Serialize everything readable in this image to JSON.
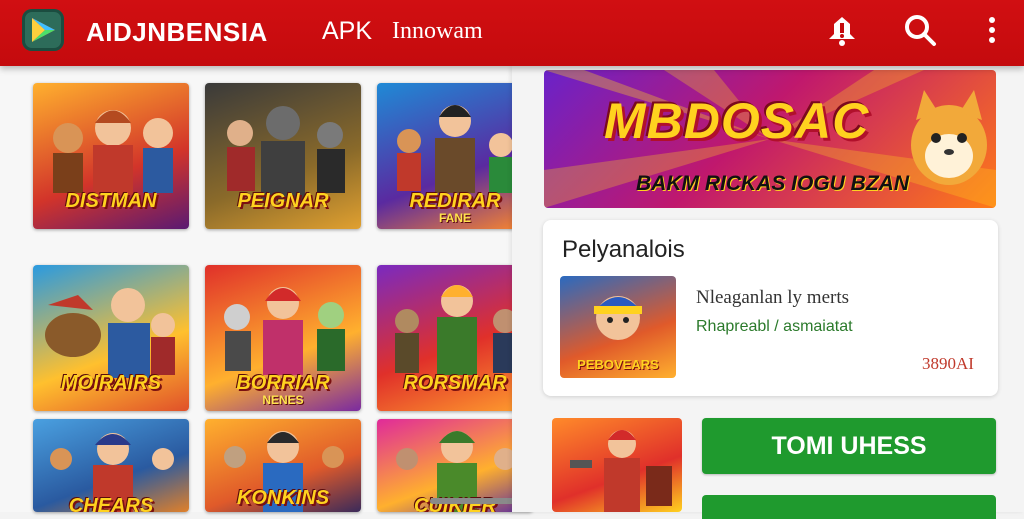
{
  "header": {
    "brand": "AIDJNBENSIA",
    "apk": "APK",
    "tagline": "Innowam",
    "icons": [
      "app-logo-icon",
      "notification-icon",
      "search-icon",
      "more-vert-icon"
    ]
  },
  "grid": {
    "tiles": [
      {
        "title": "DISTMAN",
        "sub": ""
      },
      {
        "title": "PEIGNAR",
        "sub": ""
      },
      {
        "title": "REDIRAR",
        "sub": "FANE"
      },
      {
        "title": "MOIRAIRS",
        "sub": ""
      },
      {
        "title": "BORRIAR",
        "sub": "NENES"
      },
      {
        "title": "RORSMAR",
        "sub": ""
      },
      {
        "title": "CHEARS",
        "sub": ""
      },
      {
        "title": "KONKINS",
        "sub": ""
      },
      {
        "title": "CUIKIER",
        "sub": ""
      }
    ]
  },
  "right": {
    "banner_title": "MBDOSAC",
    "banner_sub": "BAKM RICKAS IOGU BZAN",
    "card_title": "Pelyanalois",
    "card_thumb_label": "PEBOVEARS",
    "card_line1": "Nleaganlan ly merts",
    "card_line2": "Rhapreabl / asmaiatat",
    "card_price": "3890AI",
    "primary_button": "TOMI UHESS"
  },
  "colors": {
    "header": "#c40a0d",
    "accent_green": "#1f9a2e",
    "price_red": "#c0392b"
  }
}
